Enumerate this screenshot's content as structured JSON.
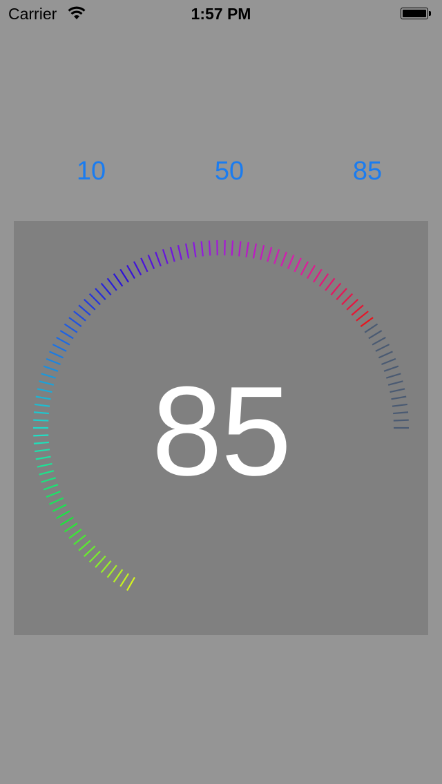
{
  "status_bar": {
    "carrier": "Carrier",
    "time": "1:57 PM",
    "wifi_icon": "wifi-icon",
    "battery_icon": "battery-icon"
  },
  "buttons": [
    {
      "label": "10"
    },
    {
      "label": "50"
    },
    {
      "label": "85"
    }
  ],
  "gauge": {
    "value": 85,
    "display": "85",
    "min": 0,
    "max": 100,
    "tick_count": 101,
    "active_colors": [
      "#d6f51e",
      "#19e63a",
      "#1fe0c8",
      "#1a6ee6",
      "#2a10d8",
      "#9a18e0",
      "#e01aa8",
      "#e8141c"
    ],
    "inactive_color": "#4a5a72",
    "background": "#808080"
  }
}
